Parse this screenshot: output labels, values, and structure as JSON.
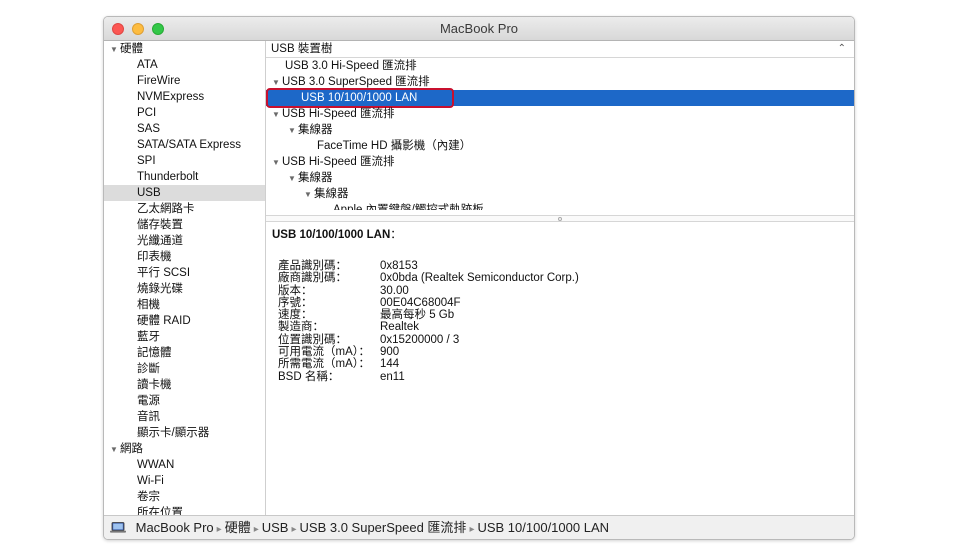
{
  "window": {
    "title": "MacBook Pro"
  },
  "sidebar": {
    "groups": [
      {
        "label": "硬體",
        "items": [
          "ATA",
          "FireWire",
          "NVMExpress",
          "PCI",
          "SAS",
          "SATA/SATA Express",
          "SPI",
          "Thunderbolt",
          "USB",
          "乙太網路卡",
          "儲存裝置",
          "光纖通道",
          "印表機",
          "平行 SCSI",
          "燒錄光碟",
          "相機",
          "硬體 RAID",
          "藍牙",
          "記憶體",
          "診斷",
          "讀卡機",
          "電源",
          "音訊",
          "顯示卡/顯示器"
        ]
      },
      {
        "label": "網路",
        "items": [
          "WWAN",
          "Wi-Fi",
          "卷宗",
          "所在位置"
        ]
      }
    ],
    "selected": "USB"
  },
  "tree": {
    "header": "USB 裝置樹",
    "rows": [
      {
        "label": "USB 3.0 Hi-Speed 匯流排",
        "indent": 0,
        "expanded": null
      },
      {
        "label": "USB 3.0 SuperSpeed 匯流排",
        "indent": 0,
        "expanded": true
      },
      {
        "label": "USB 10/100/1000 LAN",
        "indent": 1,
        "expanded": null,
        "selected": true
      },
      {
        "label": "USB Hi-Speed 匯流排",
        "indent": 0,
        "expanded": true
      },
      {
        "label": "集線器",
        "indent": 1,
        "expanded": true
      },
      {
        "label": "FaceTime HD 攝影機（內建）",
        "indent": 2,
        "expanded": null
      },
      {
        "label": "USB Hi-Speed 匯流排",
        "indent": 0,
        "expanded": true
      },
      {
        "label": "集線器",
        "indent": 1,
        "expanded": true
      },
      {
        "label": "集線器",
        "indent": 2,
        "expanded": true
      },
      {
        "label": "Apple 內置鍵盤/觸控式軌跡板",
        "indent": 3,
        "expanded": null
      }
    ]
  },
  "detail": {
    "title": "USB 10/100/1000 LAN",
    "title_suffix": "：",
    "properties": [
      {
        "key": "產品識別碼：",
        "value": "0x8153"
      },
      {
        "key": "廠商識別碼：",
        "value": "0x0bda  (Realtek Semiconductor Corp.)"
      },
      {
        "key": "版本：",
        "value": "30.00"
      },
      {
        "key": "序號：",
        "value": "00E04C68004F"
      },
      {
        "key": "速度：",
        "value": "最高每秒 5 Gb"
      },
      {
        "key": "製造商：",
        "value": "Realtek"
      },
      {
        "key": "位置識別碼：",
        "value": "0x15200000 / 3"
      },
      {
        "key": "可用電流（mA）：",
        "value": "900"
      },
      {
        "key": "所需電流（mA）：",
        "value": "144"
      },
      {
        "key": "BSD 名稱：",
        "value": "en11"
      }
    ]
  },
  "breadcrumb": {
    "items": [
      "MacBook Pro",
      "硬體",
      "USB",
      "USB 3.0 SuperSpeed 匯流排",
      "USB 10/100/1000 LAN"
    ]
  },
  "icons": {
    "tree_expanded": "disclosure-triangle-down",
    "sort": "chevron-up",
    "computer": "laptop-icon"
  },
  "colors": {
    "selection": "#1d68c8",
    "highlight_box": "#c8102e",
    "sidebar_selection": "#dcdcdc"
  }
}
